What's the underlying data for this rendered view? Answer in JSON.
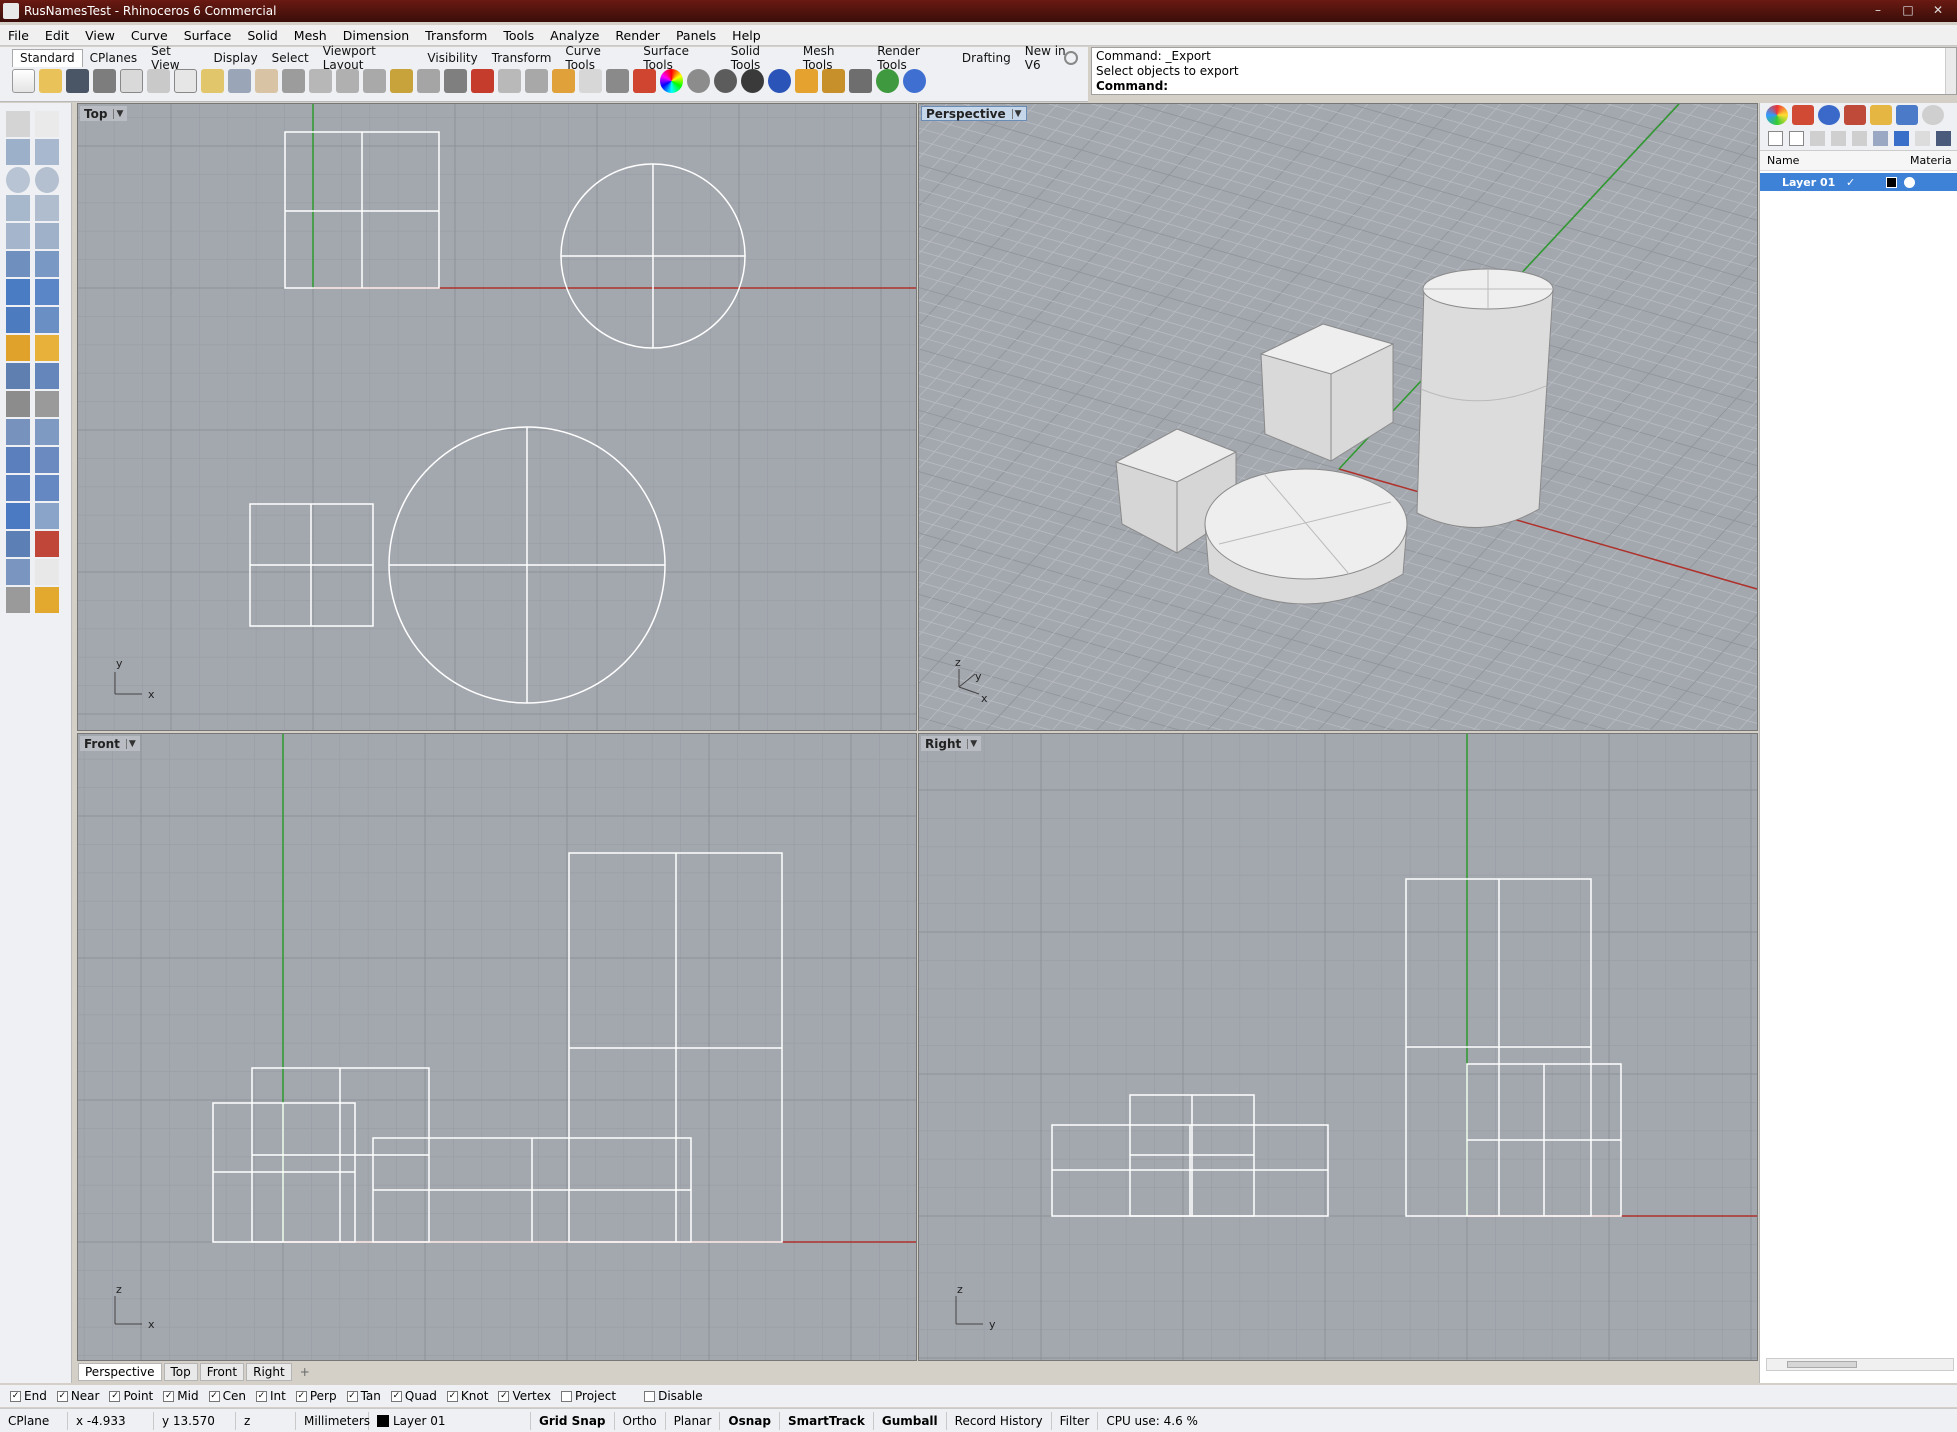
{
  "window": {
    "title": "RusNamesTest - Rhinoceros 6 Commercial"
  },
  "menu": [
    "File",
    "Edit",
    "View",
    "Curve",
    "Surface",
    "Solid",
    "Mesh",
    "Dimension",
    "Transform",
    "Tools",
    "Analyze",
    "Render",
    "Panels",
    "Help"
  ],
  "toolbar_tabs": [
    "Standard",
    "CPlanes",
    "Set View",
    "Display",
    "Select",
    "Viewport Layout",
    "Visibility",
    "Transform",
    "Curve Tools",
    "Surface Tools",
    "Solid Tools",
    "Mesh Tools",
    "Render Tools",
    "Drafting",
    "New in V6"
  ],
  "command": {
    "line1": "Command: _Export",
    "line2": "Select objects to export",
    "prompt": "Command:"
  },
  "viewports": {
    "top": {
      "label": "Top",
      "axes": [
        "y",
        "x"
      ]
    },
    "perspective": {
      "label": "Perspective",
      "axes": [
        "z",
        "y",
        "x"
      ]
    },
    "front": {
      "label": "Front",
      "axes": [
        "z",
        "x"
      ]
    },
    "right": {
      "label": "Right",
      "axes": [
        "z",
        "y"
      ]
    }
  },
  "viewport_tabs": [
    "Perspective",
    "Top",
    "Front",
    "Right"
  ],
  "viewport_tab_add": "+",
  "layers_panel": {
    "columns": [
      "Name",
      "Materia"
    ],
    "layers": [
      {
        "name": "Layer 01",
        "current": true,
        "color": "#000000"
      }
    ]
  },
  "osnaps": [
    {
      "label": "End",
      "checked": true
    },
    {
      "label": "Near",
      "checked": true
    },
    {
      "label": "Point",
      "checked": true
    },
    {
      "label": "Mid",
      "checked": true
    },
    {
      "label": "Cen",
      "checked": true
    },
    {
      "label": "Int",
      "checked": true
    },
    {
      "label": "Perp",
      "checked": true
    },
    {
      "label": "Tan",
      "checked": true
    },
    {
      "label": "Quad",
      "checked": true
    },
    {
      "label": "Knot",
      "checked": true
    },
    {
      "label": "Vertex",
      "checked": true
    },
    {
      "label": "Project",
      "checked": false
    },
    {
      "label": "Disable",
      "checked": false
    }
  ],
  "status": {
    "cplane": "CPlane",
    "x": "x -4.933",
    "y": "y 13.570",
    "z": "z",
    "units": "Millimeters",
    "layer": "Layer 01",
    "grid_snap": "Grid Snap",
    "ortho": "Ortho",
    "planar": "Planar",
    "osnap": "Osnap",
    "smarttrack": "SmartTrack",
    "gumball": "Gumball",
    "record_history": "Record History",
    "filter": "Filter",
    "cpu": "CPU use: 4.6 %"
  },
  "colors": {
    "viewport_bg": "#a3a7ae",
    "x_axis": "#b0302a",
    "y_axis": "#2d9a2d",
    "active_layer": "#3d82d6"
  }
}
